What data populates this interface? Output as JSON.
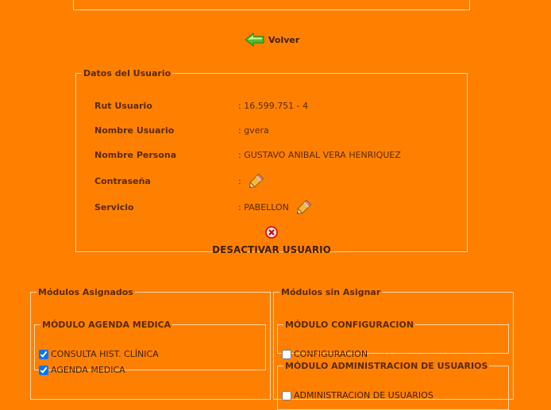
{
  "nav": {
    "back_label": "Volver"
  },
  "user_section": {
    "legend": "Datos del Usuario",
    "rut_label": "Rut Usuario",
    "rut_value": ": 16.599.751 - 4",
    "username_label": "Nombre Usuario",
    "username_value": ": gvera",
    "person_label": "Nombre Persona",
    "person_value": ": GUSTAVO ANIBAL VERA HENRIQUEZ",
    "password_label": "Contraseña",
    "password_value": ":",
    "service_label": "Servicio",
    "service_value": ": PABELLON",
    "deactivate_label": "DESACTIVAR USUARIO"
  },
  "assigned": {
    "legend": "Módulos Asignados",
    "modules": [
      {
        "title": "MÓDULO AGENDA MEDICA",
        "items": [
          {
            "label": "CONSULTA HIST. CLÍNICA",
            "checked": true
          },
          {
            "label": "AGENDA MEDICA",
            "checked": true
          }
        ]
      }
    ]
  },
  "unassigned": {
    "legend": "Módulos sin Asignar",
    "modules": [
      {
        "title": "MÓDULO CONFIGURACION",
        "items": [
          {
            "label": "CONFIGURACION",
            "checked": false
          }
        ]
      },
      {
        "title": "MÓDULO ADMINISTRACION DE USUARIOS",
        "items": [
          {
            "label": "ADMINISTRACION DE USUARIOS",
            "checked": false
          }
        ]
      }
    ]
  },
  "colors": {
    "background": "#FF8000",
    "border": "#ffd7ad",
    "text": "#5a2a00"
  },
  "icons": {
    "back": "green-arrow-left-icon",
    "edit": "pencil-icon",
    "deactivate": "red-x-icon"
  }
}
